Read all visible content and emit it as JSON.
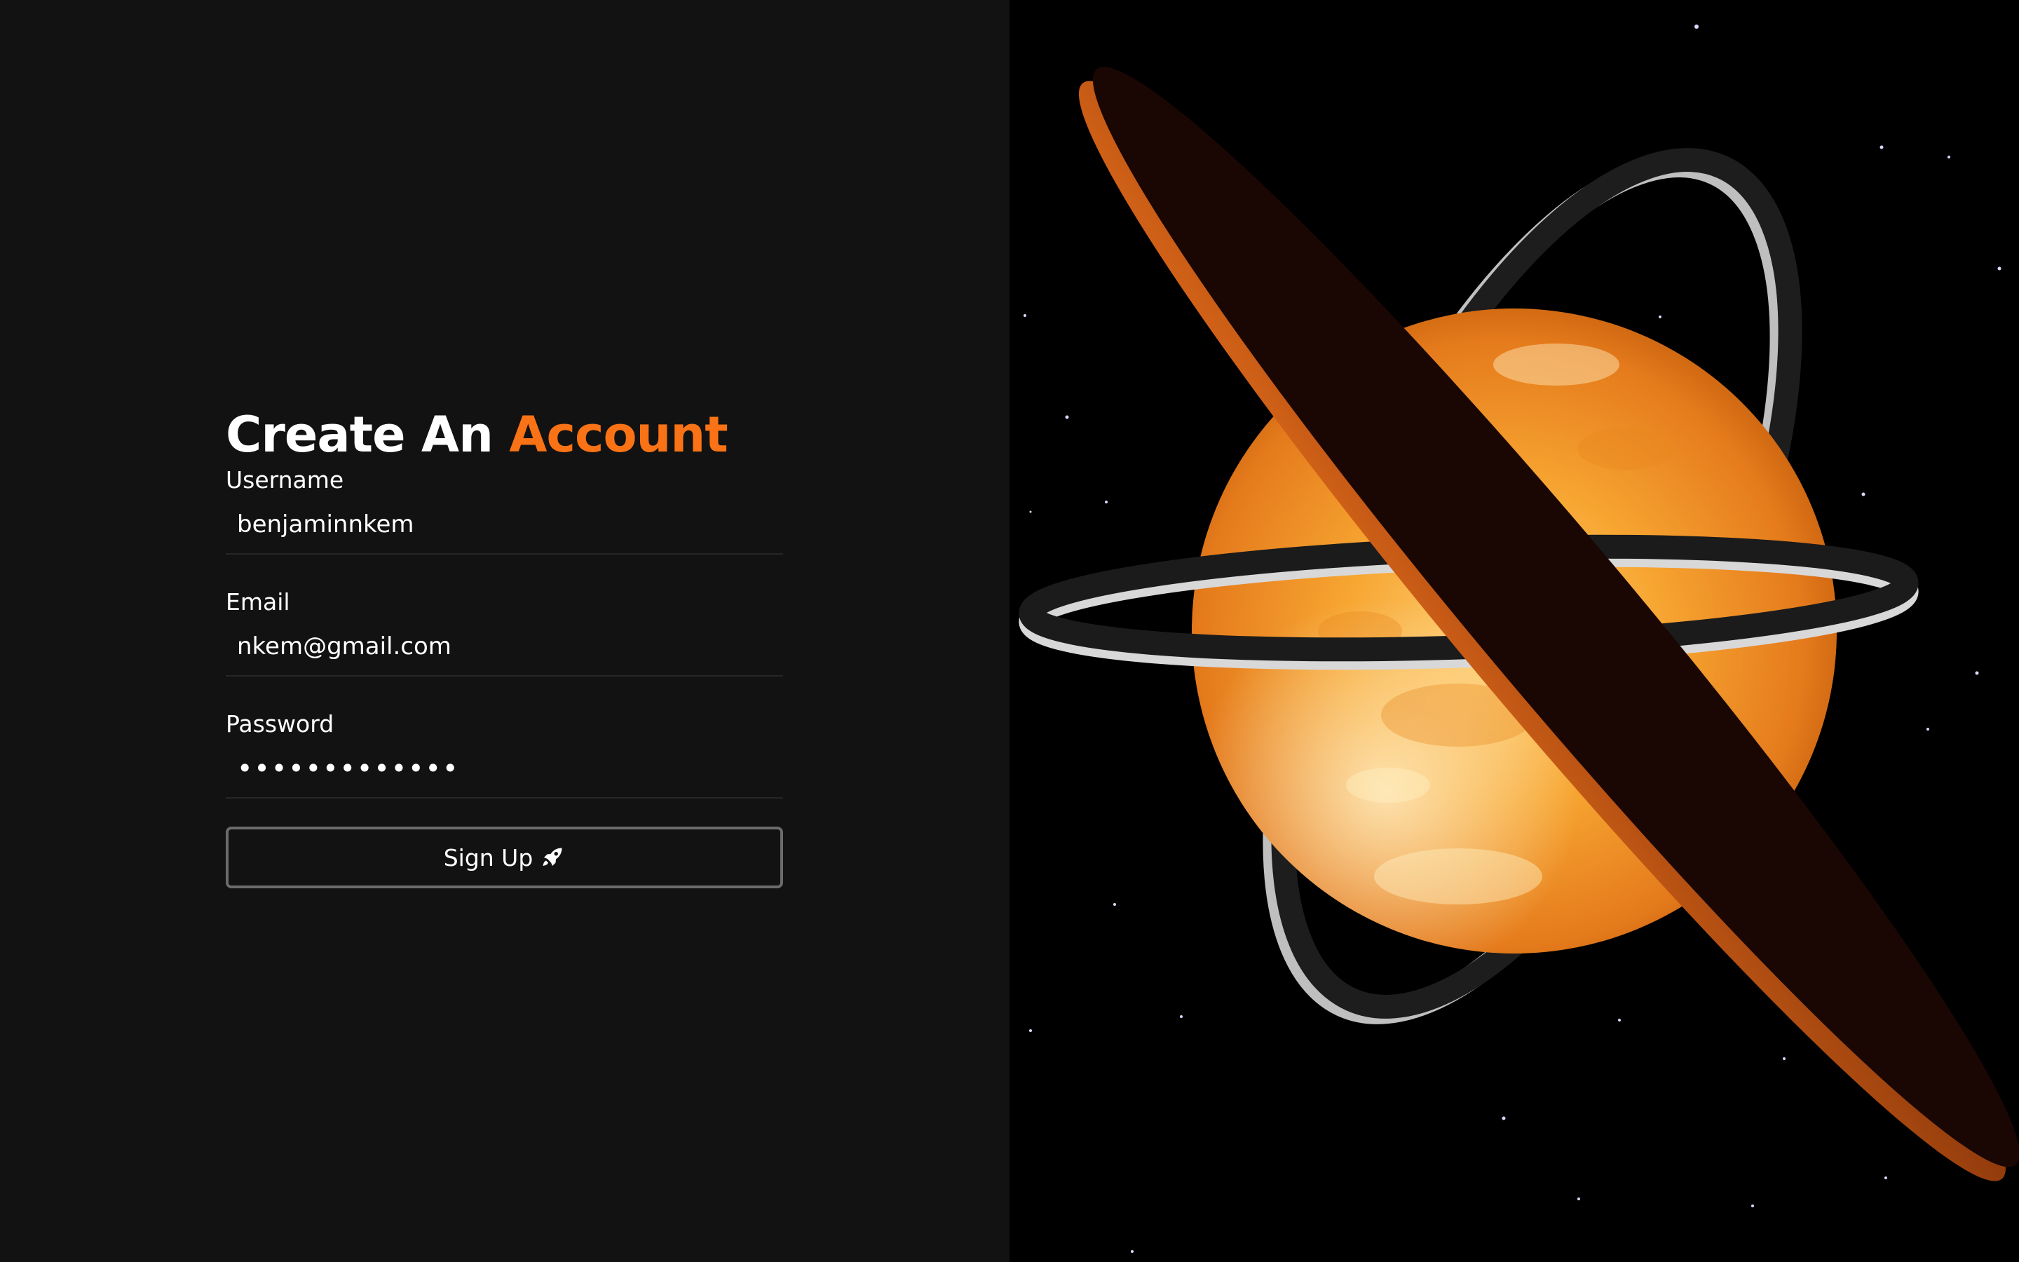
{
  "form": {
    "title_main": "Create An",
    "title_accent": "Account",
    "username_label": "Username",
    "username_value": "benjaminnkem",
    "email_label": "Email",
    "email_value": "nkem@gmail.com",
    "password_label": "Password",
    "password_value": "•••••••••••••",
    "signup_label": "Sign Up",
    "signup_icon": "rocket-icon"
  },
  "colors": {
    "background": "#121212",
    "accent": "#f97316",
    "text": "#ffffff",
    "space": "#000000",
    "sun": "#f59e0b",
    "ring_dark": "#1a0704"
  }
}
